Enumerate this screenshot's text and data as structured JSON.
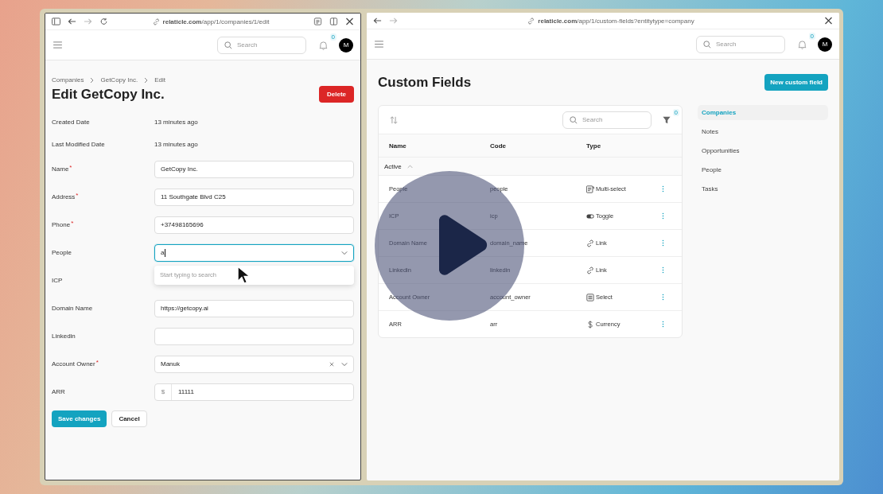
{
  "left_window": {
    "url_host": "relaticle.com",
    "url_path": "/app/1/companies/1/edit",
    "search": {
      "placeholder": "Search"
    },
    "notification_count": "0",
    "avatar": "M",
    "breadcrumbs": [
      "Companies",
      "GetCopy Inc.",
      "Edit"
    ],
    "title": "Edit GetCopy Inc.",
    "delete_button": "Delete",
    "info": [
      {
        "label": "Created Date",
        "value": "13 minutes ago"
      },
      {
        "label": "Last Modified Date",
        "value": "13 minutes ago"
      }
    ],
    "fields": [
      {
        "label": "Name",
        "required_mark": "*",
        "kind": "text",
        "value": "GetCopy Inc."
      },
      {
        "label": "Address",
        "required_mark": "*",
        "kind": "text",
        "value": "11 Southgate Blvd C25"
      },
      {
        "label": "Phone",
        "required_mark": "*",
        "kind": "text",
        "value": "+37498165696"
      },
      {
        "label": "People",
        "kind": "combobox",
        "value": "a",
        "focused": true,
        "dropdown_hint": "Start typing to search"
      },
      {
        "label": "ICP",
        "kind": "covered"
      },
      {
        "label": "Domain Name",
        "kind": "text",
        "value": "https://getcopy.ai"
      },
      {
        "label": "Linkedin",
        "kind": "text"
      },
      {
        "label": "Account Owner",
        "required_mark": "*",
        "kind": "select",
        "value": "Manuk"
      },
      {
        "label": "ARR",
        "kind": "money",
        "prefix": "$",
        "value": "11111"
      }
    ],
    "buttons": [
      {
        "label": "Save changes",
        "kind": "primary"
      },
      {
        "label": "Cancel",
        "kind": "secondary"
      }
    ]
  },
  "right_window": {
    "url_host": "relaticle.com",
    "url_path": "/app/1/custom-fields?entitytype=company",
    "search": {
      "placeholder": "Search"
    },
    "notification_count": "0",
    "avatar": "M",
    "title": "Custom Fields",
    "new_button": "New custom field",
    "table": {
      "search": {
        "placeholder": "Search"
      },
      "filter_count": "0",
      "columns": [
        "Name",
        "Code",
        "Type"
      ],
      "group": {
        "label": "Active",
        "expanded": true
      },
      "rows": [
        {
          "name": "People",
          "code": "people",
          "type": "Multi-select",
          "kind": "list"
        },
        {
          "name": "ICP",
          "code": "icp",
          "type": "Toggle",
          "kind": "toggle"
        },
        {
          "name": "Domain Name",
          "code": "domain_name",
          "type": "Link",
          "kind": "link"
        },
        {
          "name": "Linkedin",
          "code": "linkedin",
          "type": "Link",
          "kind": "link"
        },
        {
          "name": "Account Owner",
          "code": "account_owner",
          "type": "Select",
          "kind": "menu"
        },
        {
          "name": "ARR",
          "code": "arr",
          "type": "Currency",
          "kind": "dollar"
        }
      ]
    },
    "entity_nav": [
      {
        "label": "Companies",
        "selected": true
      },
      {
        "label": "Notes",
        "selected": false
      },
      {
        "label": "Opportunities",
        "selected": false
      },
      {
        "label": "People",
        "selected": false
      },
      {
        "label": "Tasks",
        "selected": false
      }
    ]
  }
}
